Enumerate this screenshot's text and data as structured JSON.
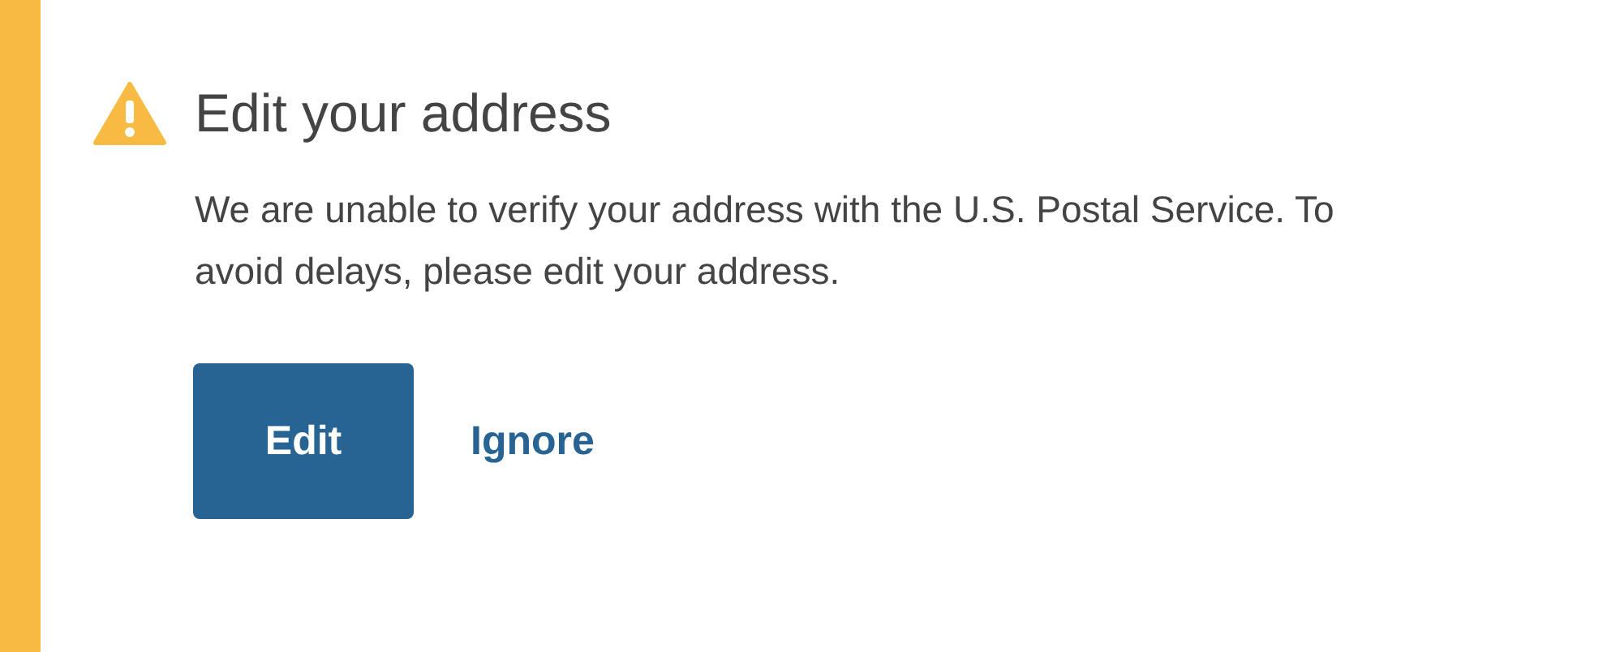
{
  "alert": {
    "kind": "warning",
    "title": "Edit your address",
    "message": "We are unable to verify your address with the U.S. Postal Service. To avoid delays, please edit your address.",
    "actions": [
      {
        "kind": "primary",
        "label": "Edit"
      },
      {
        "kind": "link",
        "label": "Ignore"
      }
    ]
  }
}
